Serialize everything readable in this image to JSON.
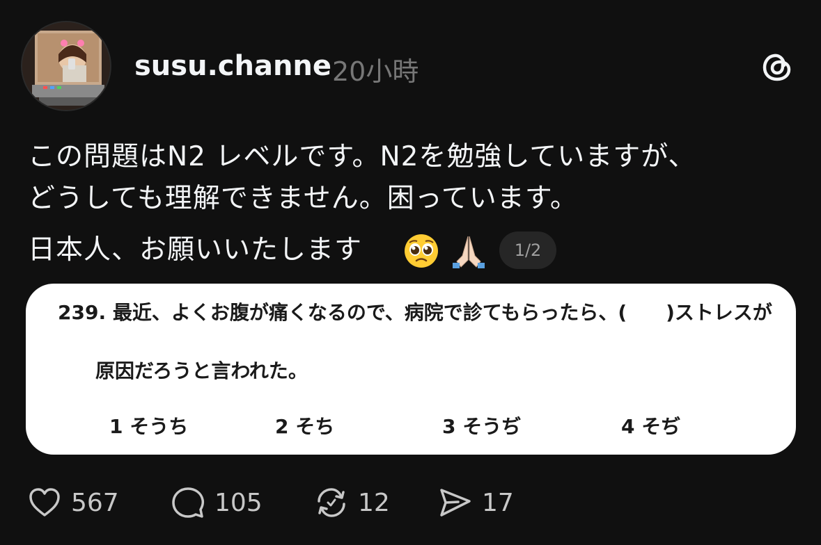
{
  "post": {
    "username": "susu.channe",
    "time": "20小時",
    "text_line1": "この問題はN2 レベルです。N2を勉強していますが、",
    "text_line2": "どうしても理解できません。困っています。",
    "text_line3": "日本人、お願いいたします",
    "emojis": [
      "pleading-face",
      "folded-hands"
    ],
    "pager": "1/2"
  },
  "image_card": {
    "question_line1": "239. 最近、よくお腹が痛くなるので、病院で診てもらったら、(　　)ストレスが",
    "question_line2": "原因だろうと言われた。",
    "options": [
      "1 そうち",
      "2 そち",
      "3 そうぢ",
      "4 そぢ"
    ]
  },
  "actions": {
    "likes": "567",
    "replies": "105",
    "reposts": "12",
    "shares": "17"
  },
  "icons": {
    "app": "threads-icon",
    "like": "heart-icon",
    "reply": "comment-icon",
    "repost": "repost-icon",
    "share": "send-icon"
  }
}
